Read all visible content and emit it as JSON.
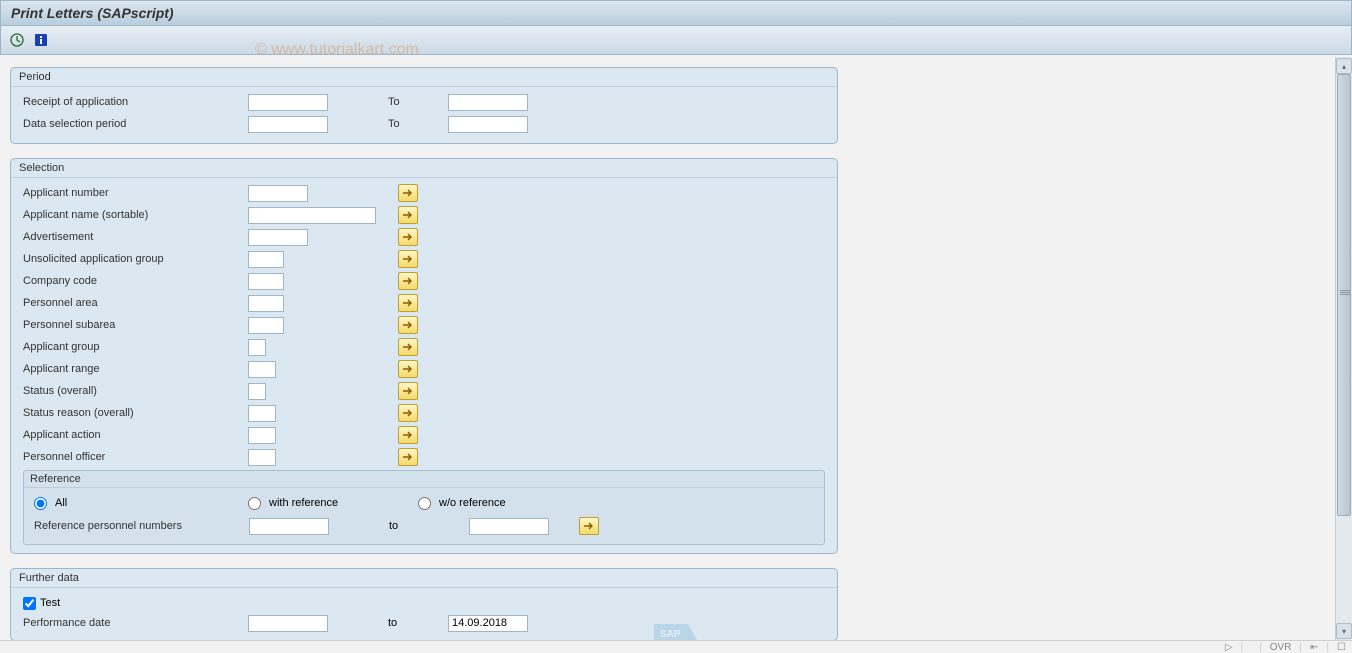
{
  "title": "Print Letters (SAPscript)",
  "watermark": "© www.tutorialkart.com",
  "panels": {
    "period": {
      "title": "Period",
      "rows": [
        {
          "label": "Receipt of application",
          "to": "To"
        },
        {
          "label": "Data selection period",
          "to": "To"
        }
      ]
    },
    "selection": {
      "title": "Selection",
      "rows": [
        {
          "label": "Applicant number",
          "w": "w60"
        },
        {
          "label": "Applicant name (sortable)",
          "w": "w128"
        },
        {
          "label": "Advertisement",
          "w": "w60"
        },
        {
          "label": "Unsolicited application group",
          "w": "w36"
        },
        {
          "label": "Company code",
          "w": "w36"
        },
        {
          "label": "Personnel area",
          "w": "w36"
        },
        {
          "label": "Personnel subarea",
          "w": "w36"
        },
        {
          "label": "Applicant group",
          "w": "w18"
        },
        {
          "label": "Applicant range",
          "w": "w28"
        },
        {
          "label": "Status (overall)",
          "w": "w18"
        },
        {
          "label": "Status reason (overall)",
          "w": "w28"
        },
        {
          "label": "Applicant action",
          "w": "w28"
        },
        {
          "label": "Personnel officer",
          "w": "w28"
        }
      ],
      "reference": {
        "title": "Reference",
        "radios": {
          "all": "All",
          "with": "with reference",
          "without": "w/o reference"
        },
        "row": {
          "label": "Reference personnel numbers",
          "to": "to"
        }
      }
    },
    "further": {
      "title": "Further data",
      "test": "Test",
      "perf_row": {
        "label": "Performance date",
        "to": "to",
        "value": "14.09.2018"
      }
    }
  },
  "status": {
    "sys": "",
    "ovr": "OVR"
  }
}
